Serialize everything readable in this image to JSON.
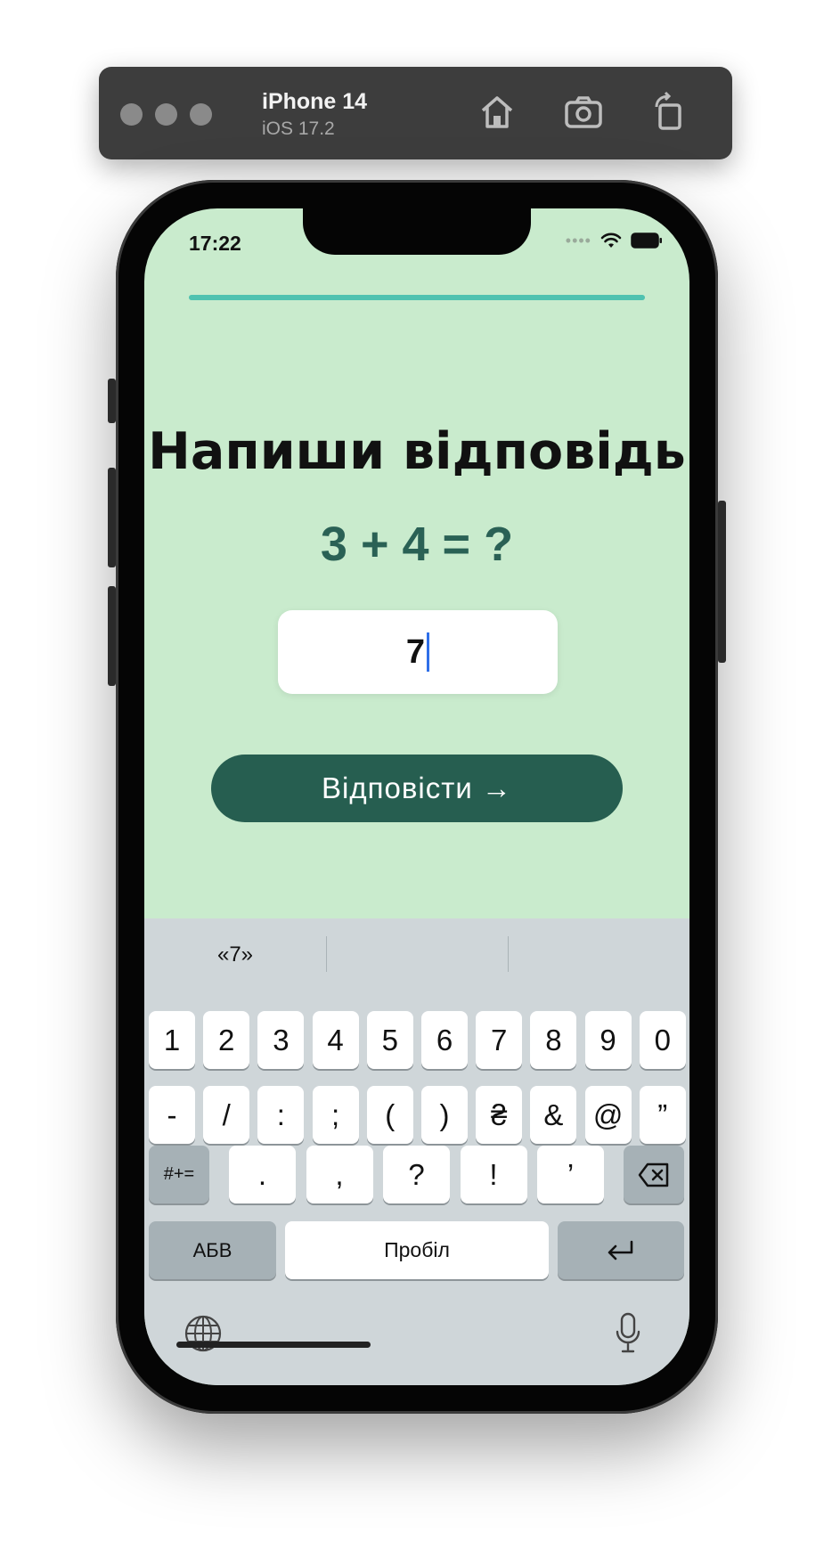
{
  "simulator": {
    "device_name": "iPhone 14",
    "os_version": "iOS 17.2",
    "toolbar_icons": [
      "home-icon",
      "screenshot-icon",
      "rotate-icon"
    ]
  },
  "status_bar": {
    "time": "17:22",
    "icons": [
      "cellular-icon",
      "wifi-icon",
      "battery-icon"
    ]
  },
  "progress": {
    "fraction": 1.0,
    "color": "#4fc2b0"
  },
  "question": {
    "headline": "Напиши відповідь",
    "equation": "3 + 4 = ?",
    "answer_value": "7"
  },
  "submit_button": {
    "label": "Відповісти →",
    "color": "#265e50"
  },
  "keyboard": {
    "suggestions": [
      "«7»",
      "",
      ""
    ],
    "row1": [
      "1",
      "2",
      "3",
      "4",
      "5",
      "6",
      "7",
      "8",
      "9",
      "0"
    ],
    "row2": [
      "-",
      "/",
      ":",
      ";",
      "(",
      ")",
      "₴",
      "&",
      "@",
      "”"
    ],
    "row3": [
      ".",
      ",",
      "?",
      "!",
      "’"
    ],
    "symbols_key": "#+=",
    "abc_key": "АБВ",
    "space_key": "Пробіл",
    "backspace_icon": "backspace-icon",
    "return_icon": "return-icon",
    "globe_icon": "globe-icon",
    "mic_icon": "microphone-icon"
  },
  "colors": {
    "screen_bg": "#c9ebcd",
    "equation_text": "#2a6155",
    "keyboard_bg": "#cfd6d9"
  }
}
